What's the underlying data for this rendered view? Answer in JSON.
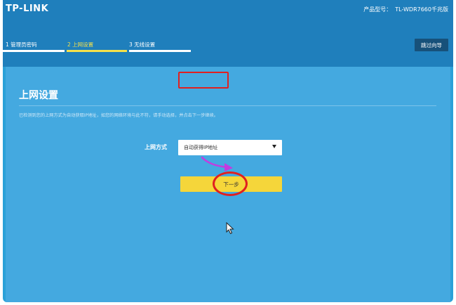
{
  "header": {
    "logo": "TP-LINK",
    "model_label": "产品型号：",
    "model_value": "TL-WDR7660千兆版"
  },
  "steps": [
    {
      "label": "1 管理员密码",
      "state": "done"
    },
    {
      "label": "2 上网设置",
      "state": "active"
    },
    {
      "label": "3 无线设置",
      "state": "pending"
    }
  ],
  "skip_label": "跳过向导",
  "page": {
    "title": "上网设置",
    "description": "已检测到您的上网方式为自动获取IP地址，如您的网络环境与此不符，请手动选择，并点击下一步继续。"
  },
  "form": {
    "mode_label": "上网方式",
    "mode_value": "自动获得IP地址"
  },
  "next_label": "下一步",
  "colors": {
    "header": "#1f7fbc",
    "content": "#44a9e0",
    "accent": "#f5d63a",
    "annotation": "#e02020",
    "arrow": "#c23ce0"
  }
}
